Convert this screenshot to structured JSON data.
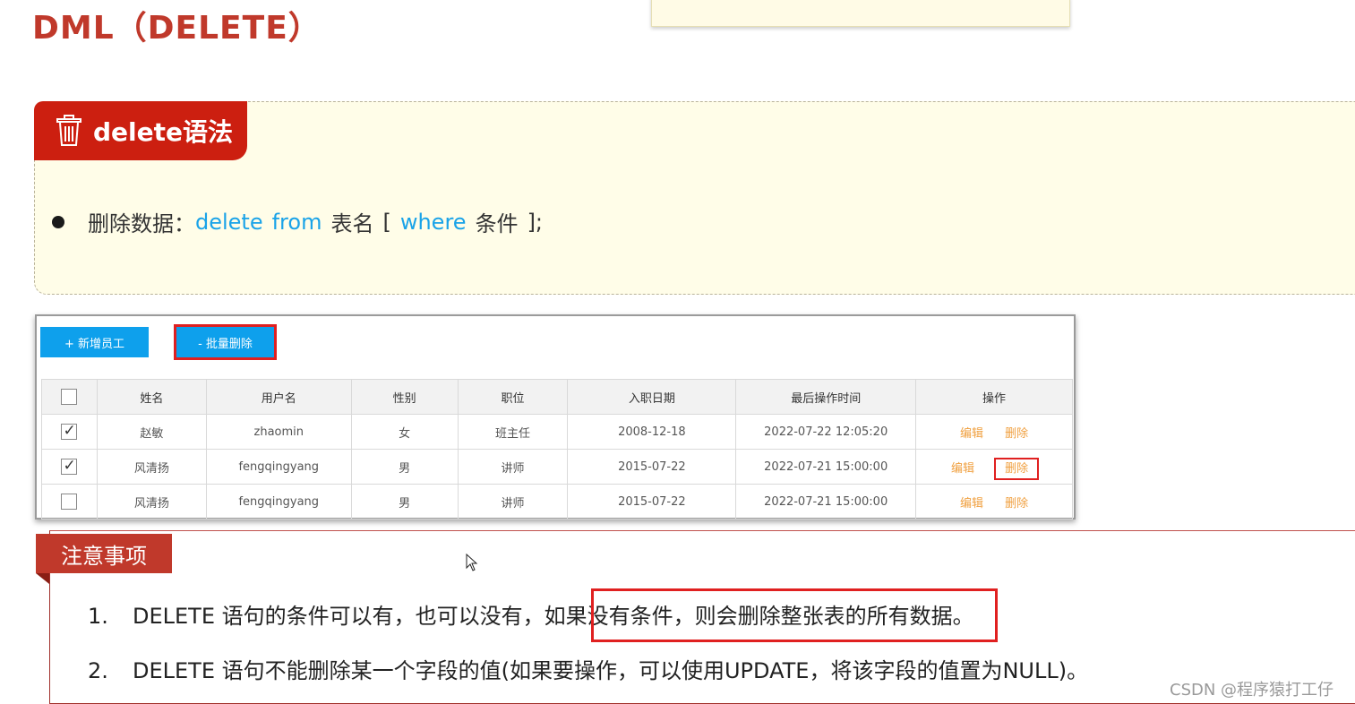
{
  "page_title": "DML（DELETE）",
  "syntax": {
    "tab_label": "delete语法",
    "bullet_prefix": "删除数据：",
    "kw_delete": "delete",
    "kw_from": "from",
    "table_name": "表名",
    "open_bracket": "[",
    "kw_where": "where",
    "condition": "条件",
    "close": "];"
  },
  "toolbar": {
    "add_label": "+ 新增员工",
    "batch_delete_label": "- 批量删除"
  },
  "table": {
    "headers": [
      "姓名",
      "用户名",
      "性别",
      "职位",
      "入职日期",
      "最后操作时间",
      "操作"
    ],
    "rows": [
      {
        "name": "赵敏",
        "username": "zhaomin",
        "gender": "女",
        "position": "班主任",
        "hire_date": "2008-12-18",
        "last_op": "2022-07-22 12:05:20",
        "edit": "编辑",
        "delete": "删除",
        "checked": true
      },
      {
        "name": "风清扬",
        "username": "fengqingyang",
        "gender": "男",
        "position": "讲师",
        "hire_date": "2015-07-22",
        "last_op": "2022-07-21 15:00:00",
        "edit": "编辑",
        "delete": "删除",
        "checked": true
      },
      {
        "name": "风清扬",
        "username": "fengqingyang",
        "gender": "男",
        "position": "讲师",
        "hire_date": "2015-07-22",
        "last_op": "2022-07-21 15:00:00",
        "edit": "编辑",
        "delete": "删除",
        "checked": false
      }
    ]
  },
  "notice": {
    "tab_label": "注意事项",
    "items": [
      {
        "num": "1.",
        "text": "DELETE 语句的条件可以有，也可以没有，如果没有条件，则会删除整张表的所有数据。"
      },
      {
        "num": "2.",
        "text": "DELETE 语句不能删除某一个字段的值(如果要操作，可以使用UPDATE，将该字段的值置为NULL)。"
      }
    ]
  },
  "watermark": "CSDN @程序猿打工仔",
  "colors": {
    "title_red": "#c0392b",
    "tab_red": "#cc1f10",
    "keyword_blue": "#1aa3e8",
    "button_blue": "#0ea0ec",
    "highlight_red": "#e02020",
    "op_orange": "#f0a040"
  }
}
